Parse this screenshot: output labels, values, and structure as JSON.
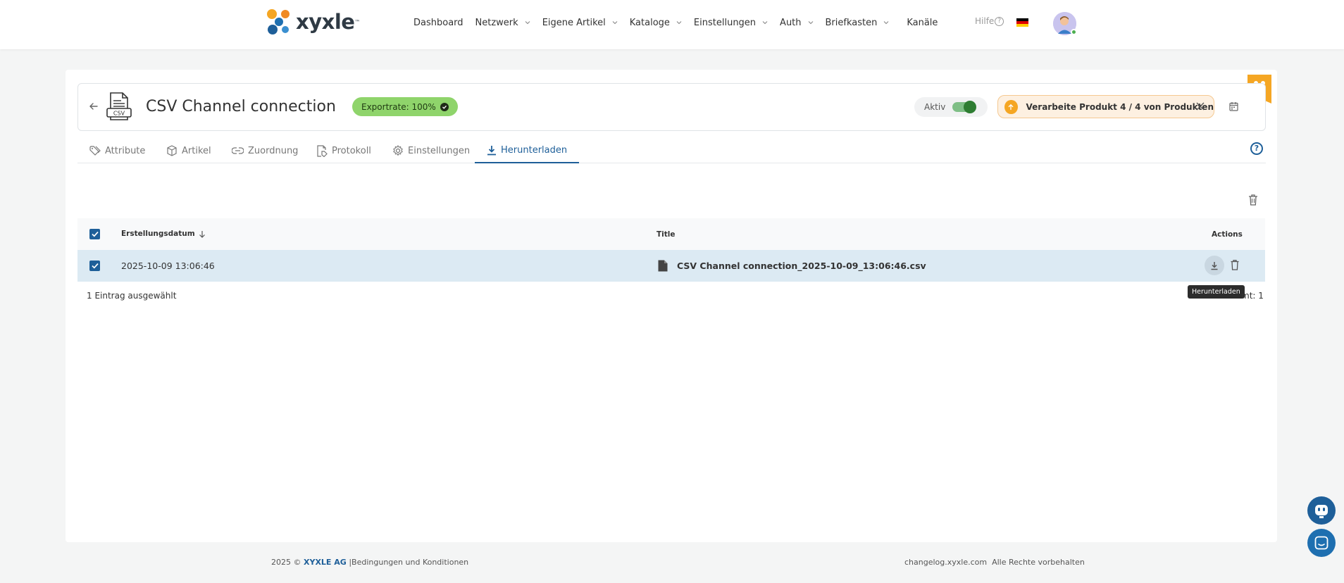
{
  "brand": {
    "name": "xyxle",
    "tm": "™"
  },
  "nav": {
    "items": [
      {
        "label": "Dashboard",
        "dropdown": false
      },
      {
        "label": "Netzwerk",
        "dropdown": true
      },
      {
        "label": "Eigene Artikel",
        "dropdown": true
      },
      {
        "label": "Kataloge",
        "dropdown": true
      },
      {
        "label": "Einstellungen",
        "dropdown": true
      },
      {
        "label": "Auth",
        "dropdown": true
      },
      {
        "label": "Briefkasten",
        "dropdown": true
      },
      {
        "label": "Kanäle",
        "dropdown": false
      }
    ],
    "help_label": "Hilfe",
    "language_flag": "de-flag-icon"
  },
  "header": {
    "title": "CSV Channel connection",
    "icon_label": "CSV",
    "export_badge": "Exportrate: 100%",
    "toggle_label": "Aktiv",
    "toggle_on": true,
    "progress_text": "Verarbeite Produkt 4 / 4 von Produkten"
  },
  "tabs": [
    {
      "label": "Attribute",
      "icon": "tag-icon",
      "active": false
    },
    {
      "label": "Artikel",
      "icon": "box-icon",
      "active": false
    },
    {
      "label": "Zuordnung",
      "icon": "link-icon",
      "active": false
    },
    {
      "label": "Protokoll",
      "icon": "file-tag-icon",
      "active": false
    },
    {
      "label": "Einstellungen",
      "icon": "gear-icon",
      "active": false
    },
    {
      "label": "Herunterladen",
      "icon": "download-icon",
      "active": true
    }
  ],
  "table": {
    "columns": [
      "Erstellungsdatum",
      "Title",
      "Actions"
    ],
    "rows": [
      {
        "date": "2025-10-09 13:06:46",
        "title": "CSV Channel connection_2025-10-09_13:06:46.csv",
        "selected": true
      }
    ],
    "selection_info": "1 Eintrag ausgewählt",
    "total_info": "mt: 1",
    "tooltip": "Herunterladen"
  },
  "footer": {
    "year": "2025 ©",
    "company": "XYXLE AG",
    "separator": "|",
    "terms": "Bedingungen und Konditionen",
    "changelog": "changelog.xyxle.com",
    "rights": "Alle Rechte vorbehalten"
  },
  "colors": {
    "primary": "#1e5f99",
    "accent": "#f5a623",
    "success": "#8fd46b",
    "row_selected": "#dceaf3"
  }
}
